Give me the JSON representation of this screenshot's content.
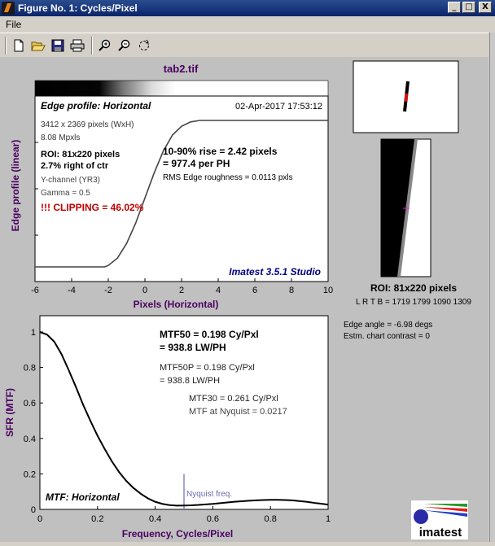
{
  "window": {
    "title": "Figure No. 1: Cycles/Pixel",
    "min_glyph": "_",
    "max_glyph": "□",
    "close_glyph": "X"
  },
  "menu": {
    "file": "File"
  },
  "figure": {
    "filename": "tab2.tif",
    "edge_panel": {
      "title": "Edge profile: Horizontal",
      "date": "02-Apr-2017 17:53:12",
      "info_lines": [
        "3412 x 2369 pixels (WxH)",
        "8.08 Mpxls"
      ],
      "roi": "ROI:  81x220 pixels",
      "roi_pos": "2.7% right of ctr",
      "channel": "Y-channel  (YR3)",
      "gamma": "Gamma = 0.5",
      "clipping": "!!! CLIPPING =  46.02%",
      "rise_1": "10-90% rise = 2.42 pixels",
      "rise_2": "= 977.4 per PH",
      "rms": "RMS Edge roughness = 0.0113 pxls",
      "brand": "Imatest 3.5.1 Studio",
      "ylabel": "Edge profile (linear)",
      "xlabel": "Pixels (Horizontal)",
      "xticks": [
        "-6",
        "-4",
        "-2",
        "0",
        "2",
        "4",
        "6",
        "8",
        "10"
      ]
    },
    "mtf_panel": {
      "title": "MTF: Horizontal",
      "mtf50_1": "MTF50 = 0.198 Cy/Pxl",
      "mtf50_2": "= 938.8 LW/PH",
      "mtf50p_1": "MTF50P = 0.198 Cy/Pxl",
      "mtf50p_2": "= 938.8 LW/PH",
      "mtf30": "MTF30 = 0.261 Cy/Pxl",
      "nyq_mtf": "MTF at Nyquist = 0.0217",
      "nyquist_label": "Nyquist freq.",
      "ylabel": "SFR (MTF)",
      "xlabel": "Frequency, Cycles/Pixel",
      "xticks": [
        "0",
        "0.2",
        "0.4",
        "0.6",
        "0.8",
        "1"
      ],
      "yticks": [
        "0",
        "0.2",
        "0.4",
        "0.6",
        "0.8",
        "1"
      ]
    },
    "roi_panel": {
      "roi": "ROI:  81x220 pixels",
      "lrtb": "L R  T B = 1719 1799   1090 1309"
    },
    "edge_angle": "Edge angle = -6.98 degs",
    "chart_contrast": "Estm. chart contrast = 0",
    "logo_text": "imatest",
    "colors": {
      "clipping": "#c00000",
      "brand": "#000080",
      "label": "#4b0060",
      "nyquist": "#6a6ab0"
    }
  },
  "chart_data": [
    {
      "type": "line",
      "title": "Edge profile: Horizontal",
      "xlabel": "Pixels (Horizontal)",
      "ylabel": "Edge profile (linear)",
      "xlim": [
        -6,
        10
      ],
      "ylim": [
        0,
        1
      ],
      "series": [
        {
          "x": [
            -6,
            -4,
            -2.2,
            -2,
            -1.5,
            -1,
            -0.5,
            0,
            0.5,
            1,
            1.5,
            2,
            2.5,
            3,
            4,
            6,
            8,
            10
          ],
          "y": [
            0,
            0,
            0,
            0.01,
            0.06,
            0.16,
            0.3,
            0.47,
            0.64,
            0.79,
            0.9,
            0.96,
            0.99,
            1.0,
            1.0,
            1.0,
            1.0,
            1.0
          ]
        }
      ]
    },
    {
      "type": "line",
      "title": "MTF: Horizontal",
      "xlabel": "Frequency, Cycles/Pixel",
      "ylabel": "SFR (MTF)",
      "xlim": [
        0,
        1
      ],
      "ylim": [
        0,
        1.05
      ],
      "series": [
        {
          "x": [
            0,
            0.025,
            0.05,
            0.075,
            0.1,
            0.125,
            0.15,
            0.175,
            0.2,
            0.225,
            0.25,
            0.275,
            0.3,
            0.325,
            0.35,
            0.375,
            0.4,
            0.425,
            0.45,
            0.475,
            0.5,
            0.525,
            0.55,
            0.575,
            0.6,
            0.625,
            0.65,
            0.675,
            0.7,
            0.725,
            0.75,
            0.775,
            0.8,
            0.825,
            0.85,
            0.875,
            0.9,
            0.925,
            0.95,
            0.975,
            1.0
          ],
          "y": [
            1.0,
            0.985,
            0.945,
            0.875,
            0.785,
            0.69,
            0.59,
            0.5,
            0.415,
            0.34,
            0.27,
            0.21,
            0.16,
            0.12,
            0.088,
            0.062,
            0.043,
            0.031,
            0.024,
            0.021,
            0.022,
            0.023,
            0.025,
            0.028,
            0.031,
            0.035,
            0.039,
            0.043,
            0.046,
            0.049,
            0.051,
            0.053,
            0.054,
            0.054,
            0.053,
            0.051,
            0.047,
            0.043,
            0.037,
            0.032,
            0.027
          ]
        }
      ],
      "annotations": [
        {
          "text": "Nyquist freq.",
          "x": 0.5,
          "y": 0.2
        }
      ]
    }
  ]
}
